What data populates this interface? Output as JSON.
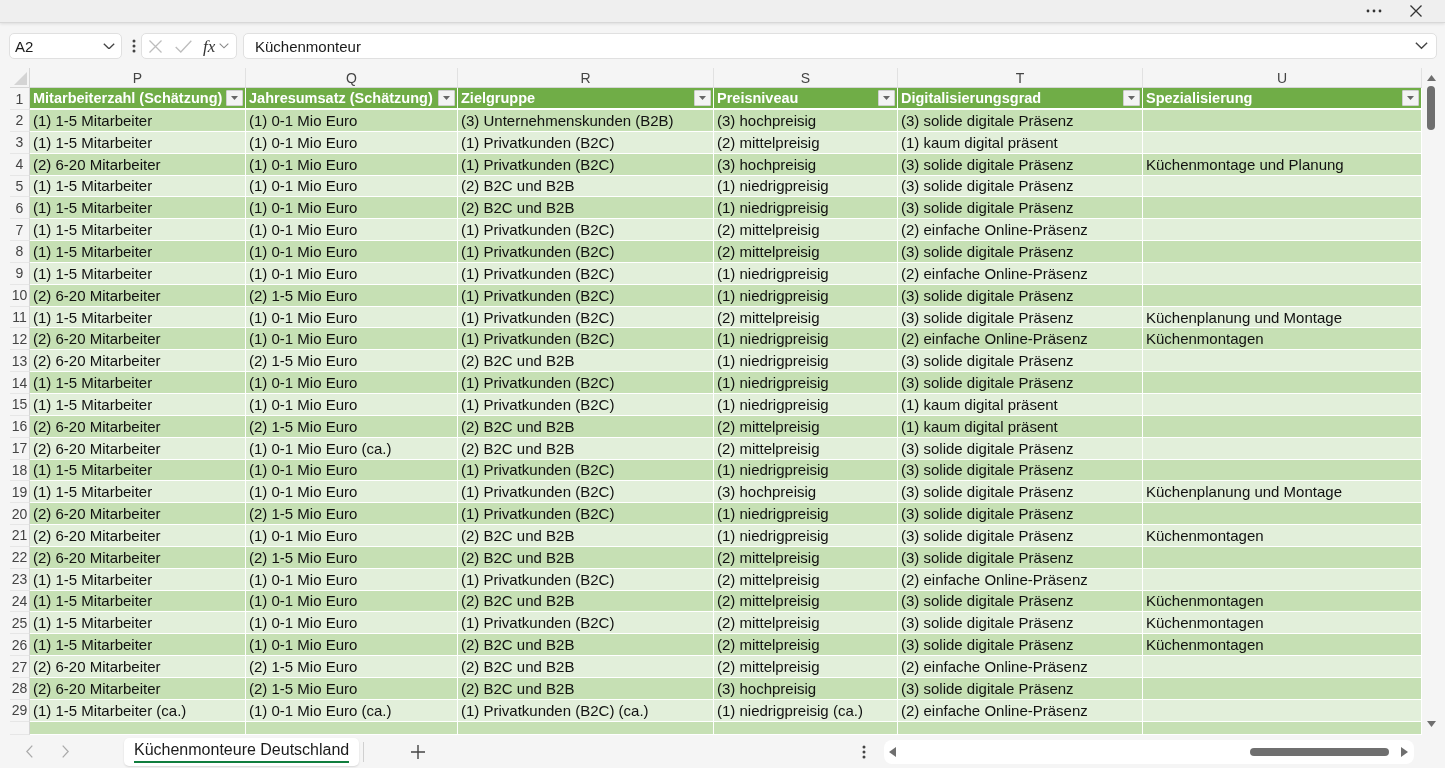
{
  "formula_bar": {
    "name_box": "A2",
    "function_button": "fx",
    "formula": "Küchenmonteur"
  },
  "column_letters": [
    "P",
    "Q",
    "R",
    "S",
    "T",
    "U"
  ],
  "table": {
    "header_row_number": "1",
    "columns": [
      "Mitarbeiterzahl (Schätzung)",
      "Jahresumsatz (Schätzung)",
      "Zielgruppe",
      "Preisniveau",
      "Digitalisierungsgrad",
      "Spezialisierung"
    ],
    "rows": [
      {
        "number": "2",
        "cells": [
          "(1) 1-5 Mitarbeiter",
          "(1) 0-1 Mio Euro",
          "(3) Unternehmenskunden (B2B)",
          "(3) hochpreisig",
          "(3) solide digitale Präsenz"
        ]
      },
      {
        "number": "3",
        "cells": [
          "(1) 1-5 Mitarbeiter",
          "(1) 0-1 Mio Euro",
          "(1) Privatkunden (B2C)",
          "(2) mittelpreisig",
          "(1) kaum digital präsent"
        ]
      },
      {
        "number": "4",
        "cells": [
          "(2) 6-20 Mitarbeiter",
          "(1) 0-1 Mio Euro",
          "(1) Privatkunden (B2C)",
          "(3) hochpreisig",
          "(3) solide digitale Präsenz",
          "Küchenmontage und Planung"
        ]
      },
      {
        "number": "5",
        "cells": [
          "(1) 1-5 Mitarbeiter",
          "(1) 0-1 Mio Euro",
          "(2) B2C und B2B",
          "(1) niedrigpreisig",
          "(3) solide digitale Präsenz"
        ]
      },
      {
        "number": "6",
        "cells": [
          "(1) 1-5 Mitarbeiter",
          "(1) 0-1 Mio Euro",
          "(2) B2C und B2B",
          "(1) niedrigpreisig",
          "(3) solide digitale Präsenz"
        ]
      },
      {
        "number": "7",
        "cells": [
          "(1) 1-5 Mitarbeiter",
          "(1) 0-1 Mio Euro",
          "(1) Privatkunden (B2C)",
          "(2) mittelpreisig",
          "(2) einfache Online-Präsenz"
        ]
      },
      {
        "number": "8",
        "cells": [
          "(1) 1-5 Mitarbeiter",
          "(1) 0-1 Mio Euro",
          "(1) Privatkunden (B2C)",
          "(2) mittelpreisig",
          "(3) solide digitale Präsenz"
        ]
      },
      {
        "number": "9",
        "cells": [
          "(1) 1-5 Mitarbeiter",
          "(1) 0-1 Mio Euro",
          "(1) Privatkunden (B2C)",
          "(1) niedrigpreisig",
          "(2) einfache Online-Präsenz"
        ]
      },
      {
        "number": "10",
        "cells": [
          "(2) 6-20 Mitarbeiter",
          "(2) 1-5 Mio Euro",
          "(1) Privatkunden (B2C)",
          "(1) niedrigpreisig",
          "(3) solide digitale Präsenz"
        ]
      },
      {
        "number": "11",
        "cells": [
          "(1) 1-5 Mitarbeiter",
          "(1) 0-1 Mio Euro",
          "(1) Privatkunden (B2C)",
          "(2) mittelpreisig",
          "(3) solide digitale Präsenz",
          "Küchenplanung und Montage"
        ]
      },
      {
        "number": "12",
        "cells": [
          "(2) 6-20 Mitarbeiter",
          "(1) 0-1 Mio Euro",
          "(1) Privatkunden (B2C)",
          "(1) niedrigpreisig",
          "(2) einfache Online-Präsenz",
          "Küchenmontagen"
        ]
      },
      {
        "number": "13",
        "cells": [
          "(2) 6-20 Mitarbeiter",
          "(2) 1-5 Mio Euro",
          "(2) B2C und B2B",
          "(1) niedrigpreisig",
          "(3) solide digitale Präsenz"
        ]
      },
      {
        "number": "14",
        "cells": [
          "(1) 1-5 Mitarbeiter",
          "(1) 0-1 Mio Euro",
          "(1) Privatkunden (B2C)",
          "(1) niedrigpreisig",
          "(3) solide digitale Präsenz"
        ]
      },
      {
        "number": "15",
        "cells": [
          "(1) 1-5 Mitarbeiter",
          "(1) 0-1 Mio Euro",
          "(1) Privatkunden (B2C)",
          "(1) niedrigpreisig",
          "(1) kaum digital präsent"
        ]
      },
      {
        "number": "16",
        "cells": [
          "(2) 6-20 Mitarbeiter",
          "(2) 1-5 Mio Euro",
          "(2) B2C und B2B",
          "(2) mittelpreisig",
          "(1) kaum digital präsent"
        ]
      },
      {
        "number": "17",
        "cells": [
          "(2) 6-20 Mitarbeiter",
          "(1) 0-1 Mio Euro (ca.)",
          "(2) B2C und B2B",
          "(2) mittelpreisig",
          "(3) solide digitale Präsenz"
        ]
      },
      {
        "number": "18",
        "cells": [
          "(1) 1-5 Mitarbeiter",
          "(1) 0-1 Mio Euro",
          "(1) Privatkunden (B2C)",
          "(1) niedrigpreisig",
          "(3) solide digitale Präsenz"
        ]
      },
      {
        "number": "19",
        "cells": [
          "(1) 1-5 Mitarbeiter",
          "(1) 0-1 Mio Euro",
          "(1) Privatkunden (B2C)",
          "(3) hochpreisig",
          "(3) solide digitale Präsenz",
          "Küchenplanung und Montage"
        ]
      },
      {
        "number": "20",
        "cells": [
          "(2) 6-20 Mitarbeiter",
          "(2) 1-5 Mio Euro",
          "(1) Privatkunden (B2C)",
          "(1) niedrigpreisig",
          "(3) solide digitale Präsenz"
        ]
      },
      {
        "number": "21",
        "cells": [
          "(2) 6-20 Mitarbeiter",
          "(1) 0-1 Mio Euro",
          "(2) B2C und B2B",
          "(1) niedrigpreisig",
          "(3) solide digitale Präsenz",
          "Küchenmontagen"
        ]
      },
      {
        "number": "22",
        "cells": [
          "(2) 6-20 Mitarbeiter",
          "(2) 1-5 Mio Euro",
          "(2) B2C und B2B",
          "(2) mittelpreisig",
          "(3) solide digitale Präsenz"
        ]
      },
      {
        "number": "23",
        "cells": [
          "(1) 1-5 Mitarbeiter",
          "(1) 0-1 Mio Euro",
          "(1) Privatkunden (B2C)",
          "(2) mittelpreisig",
          "(2) einfache Online-Präsenz"
        ]
      },
      {
        "number": "24",
        "cells": [
          "(1) 1-5 Mitarbeiter",
          "(1) 0-1 Mio Euro",
          "(2) B2C und B2B",
          "(2) mittelpreisig",
          "(3) solide digitale Präsenz",
          "Küchenmontagen"
        ]
      },
      {
        "number": "25",
        "cells": [
          "(1) 1-5 Mitarbeiter",
          "(1) 0-1 Mio Euro",
          "(1) Privatkunden (B2C)",
          "(2) mittelpreisig",
          "(3) solide digitale Präsenz",
          "Küchenmontagen"
        ]
      },
      {
        "number": "26",
        "cells": [
          "(1) 1-5 Mitarbeiter",
          "(1) 0-1 Mio Euro",
          "(2) B2C und B2B",
          "(2) mittelpreisig",
          "(3) solide digitale Präsenz",
          "Küchenmontagen"
        ]
      },
      {
        "number": "27",
        "cells": [
          "(2) 6-20 Mitarbeiter",
          "(2) 1-5 Mio Euro",
          "(2) B2C und B2B",
          "(2) mittelpreisig",
          "(2) einfache Online-Präsenz"
        ]
      },
      {
        "number": "28",
        "cells": [
          "(2) 6-20 Mitarbeiter",
          "(2) 1-5 Mio Euro",
          "(2) B2C und B2B",
          "(3) hochpreisig",
          "(3) solide digitale Präsenz"
        ]
      },
      {
        "number": "29",
        "cells": [
          "(1) 1-5 Mitarbeiter (ca.)",
          "(1) 0-1 Mio Euro (ca.)",
          "(1) Privatkunden (B2C) (ca.)",
          "(1) niedrigpreisig (ca.)",
          "(2) einfache Online-Präsenz"
        ]
      }
    ]
  },
  "sheet_tabs": [
    {
      "label": "Küchenmonteure Deutschland",
      "selected": true
    }
  ]
}
